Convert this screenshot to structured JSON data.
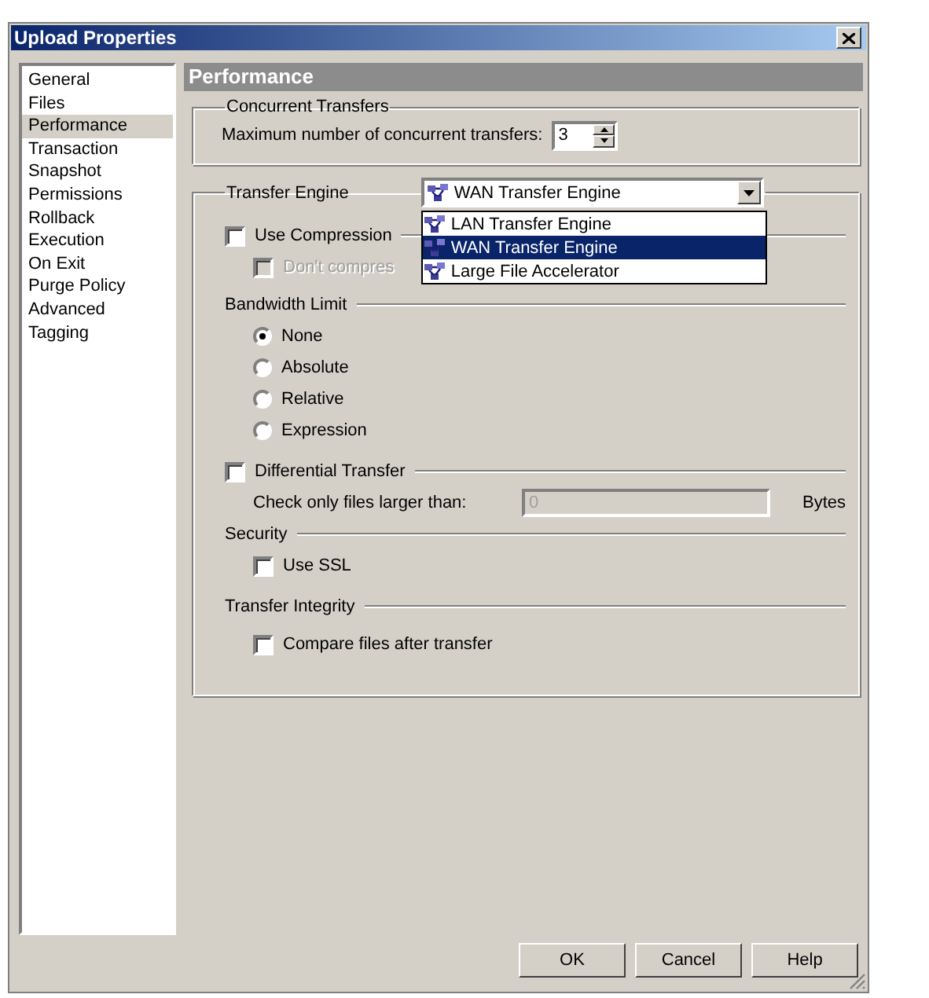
{
  "window": {
    "title": "Upload Properties"
  },
  "sidebar": {
    "items": [
      {
        "label": "General",
        "selected": false
      },
      {
        "label": "Files",
        "selected": false
      },
      {
        "label": "Performance",
        "selected": true
      },
      {
        "label": "Transaction",
        "selected": false
      },
      {
        "label": "Snapshot",
        "selected": false
      },
      {
        "label": "Permissions",
        "selected": false
      },
      {
        "label": "Rollback",
        "selected": false
      },
      {
        "label": "Execution",
        "selected": false
      },
      {
        "label": "On Exit",
        "selected": false
      },
      {
        "label": "Purge Policy",
        "selected": false
      },
      {
        "label": "Advanced",
        "selected": false
      },
      {
        "label": "Tagging",
        "selected": false
      }
    ]
  },
  "page": {
    "title": "Performance"
  },
  "concurrent": {
    "title": "Concurrent Transfers",
    "label": "Maximum number of concurrent transfers:",
    "value": "3"
  },
  "engine": {
    "title": "Transfer Engine",
    "value": "WAN Transfer Engine",
    "expanded": true,
    "options": [
      {
        "label": "LAN Transfer Engine",
        "selected": false
      },
      {
        "label": "WAN Transfer Engine",
        "selected": true
      },
      {
        "label": "Large File Accelerator",
        "selected": false
      }
    ]
  },
  "compression": {
    "label": "Use Compression",
    "checked": false,
    "dont_compress": {
      "label": "Don't compres",
      "checked": false,
      "disabled": true
    }
  },
  "bandwidth": {
    "title": "Bandwidth Limit",
    "options": [
      {
        "label": "None",
        "selected": true
      },
      {
        "label": "Absolute",
        "selected": false
      },
      {
        "label": "Relative",
        "selected": false
      },
      {
        "label": "Expression",
        "selected": false
      }
    ]
  },
  "differential": {
    "label": "Differential Transfer",
    "checked": false,
    "size_label": "Check only files larger than:",
    "size_value": "0",
    "disabled": true,
    "unit": "Bytes"
  },
  "security": {
    "title": "Security",
    "ssl": {
      "label": "Use SSL",
      "checked": false
    }
  },
  "integrity": {
    "title": "Transfer Integrity",
    "compare": {
      "label": "Compare files after transfer",
      "checked": false
    }
  },
  "buttons": [
    "OK",
    "Cancel",
    "Help"
  ]
}
